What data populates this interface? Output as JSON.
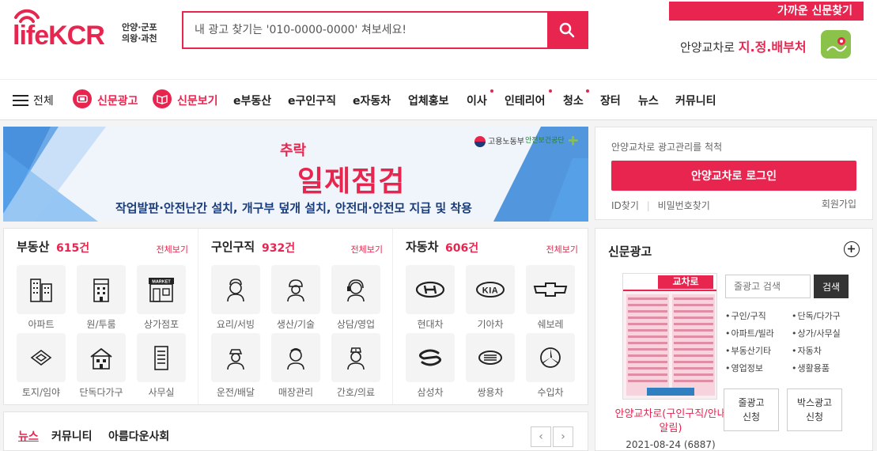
{
  "logo": {
    "text": "lifeKCR",
    "sub1": "안양·군포",
    "sub2": "의왕·과천"
  },
  "search": {
    "placeholder": "내 광고 찾기는 '010-0000-0000' 쳐보세요!"
  },
  "news_find": {
    "tag": "가까운 신문찾기",
    "brand": "안양교차로",
    "keyword": "지.정.배부처"
  },
  "nav": {
    "all_label": "전체",
    "items": [
      "신문광고",
      "신문보기",
      "e부동산",
      "e구인구직",
      "e자동차",
      "업체홍보",
      "이사",
      "인테리어",
      "청소",
      "장터",
      "뉴스",
      "커뮤니티"
    ]
  },
  "banner": {
    "title1": "추락",
    "title2": "일제점검",
    "desc": "작업발판·안전난간 설치, 개구부 덮개 설치, 안전대·안전모 지급 및 착용",
    "logo1": "고용노동부",
    "logo2": "안전보건공단"
  },
  "categories": [
    {
      "title": "부동산",
      "count": "615건",
      "more": "전체보기",
      "items": [
        "아파트",
        "원/투룸",
        "상가점포",
        "토지/임야",
        "단독다가구",
        "사무실"
      ]
    },
    {
      "title": "구인구직",
      "count": "932건",
      "more": "전체보기",
      "items": [
        "요리/서빙",
        "생산/기술",
        "상담/영업",
        "운전/배달",
        "매장관리",
        "간호/의료"
      ]
    },
    {
      "title": "자동차",
      "count": "606건",
      "more": "전체보기",
      "items": [
        "현대차",
        "기아차",
        "쉐보레",
        "삼성차",
        "쌍용차",
        "수입차"
      ]
    }
  ],
  "market_sign": "MARKET",
  "news_tabs": [
    "뉴스",
    "커뮤니티",
    "아름다운사회"
  ],
  "pager": {
    "prev": "‹",
    "next": "›"
  },
  "login": {
    "hint": "안양교차로 광고관리를 척척",
    "button": "안양교차로 로그인",
    "id_find": "ID찾기",
    "pw_find": "비밀번호찾기",
    "join": "회원가입"
  },
  "paper": {
    "title": "신문광고",
    "caption": "안양교차로(구인구직/안내알림)",
    "date": "2021-08-24 (6887)",
    "search_placeholder": "줄광고 검색",
    "search_button": "검색",
    "links": [
      "구인/구직",
      "단독/다가구",
      "아파트/빌라",
      "상가/사무실",
      "부동산기타",
      "자동차",
      "영업정보",
      "생활용품"
    ],
    "apply1": "줄광고\n신청",
    "apply2": "박스광고\n신청",
    "thumb_title": "교차로"
  },
  "colors": {
    "accent": "#e8254f",
    "navy": "#1a3c7b"
  }
}
